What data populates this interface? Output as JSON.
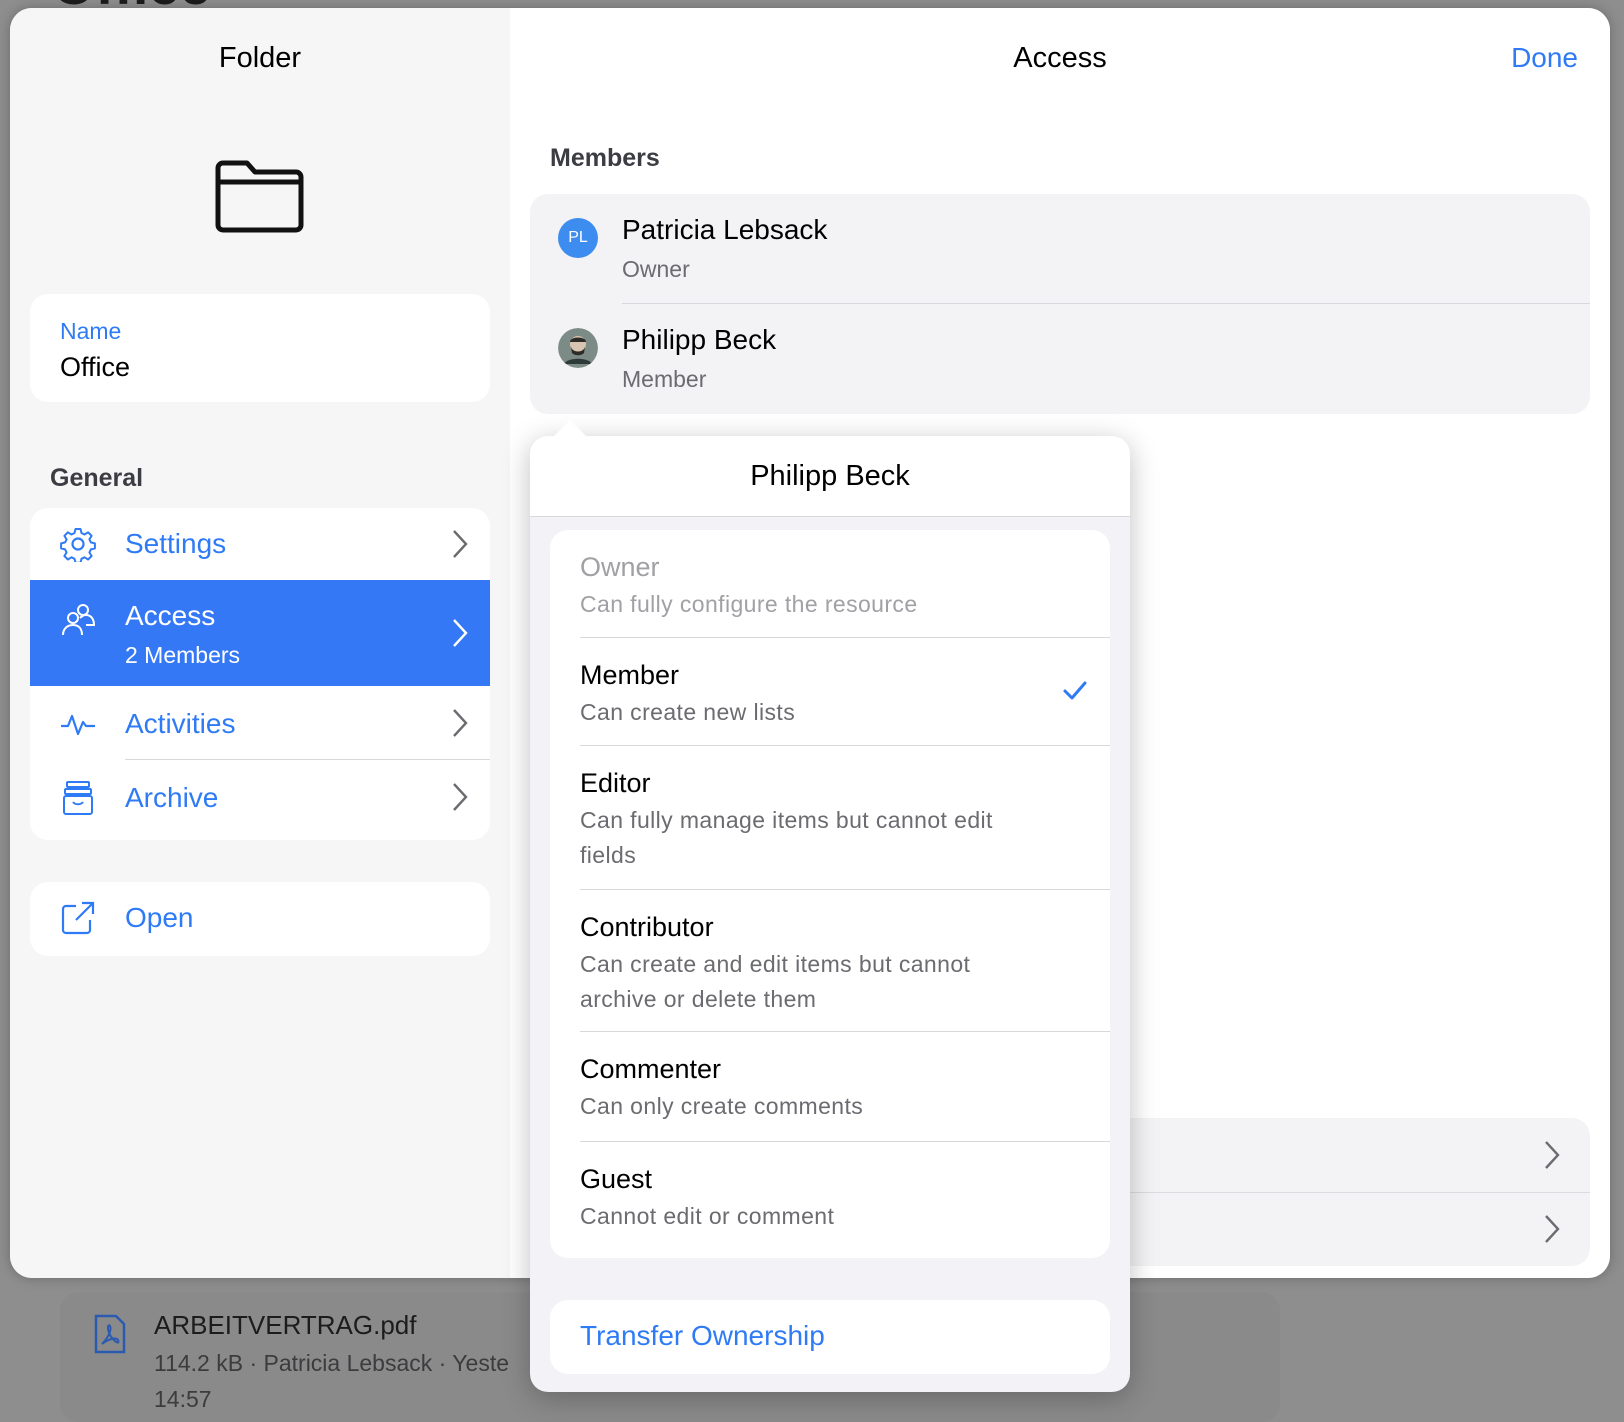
{
  "background": {
    "title": "Office",
    "file": {
      "name": "ARBEITVERTRAG.pdf",
      "meta": "114.2 kB · Patricia Lebsack · Yeste",
      "meta2": "14:57"
    }
  },
  "left": {
    "title": "Folder",
    "folder_icon": "folder-icon",
    "name_label": "Name",
    "name_value": "Office",
    "section_general": "General",
    "items": [
      {
        "label": "Settings",
        "icon": "gear-icon"
      },
      {
        "label": "Access",
        "sub": "2 Members",
        "icon": "people-icon",
        "selected": true
      },
      {
        "label": "Activities",
        "icon": "activity-icon"
      },
      {
        "label": "Archive",
        "icon": "archive-icon"
      }
    ],
    "open_label": "Open"
  },
  "right": {
    "title": "Access",
    "done_label": "Done",
    "members_header": "Members",
    "members": [
      {
        "name": "Patricia Lebsack",
        "role": "Owner",
        "initials": "PL"
      },
      {
        "name": "Philipp Beck",
        "role": "Member"
      }
    ]
  },
  "popover": {
    "title": "Philipp Beck",
    "roles": [
      {
        "name": "Owner",
        "desc": "Can fully configure the resource",
        "disabled": true
      },
      {
        "name": "Member",
        "desc": "Can create new lists",
        "selected": true
      },
      {
        "name": "Editor",
        "desc": "Can fully manage items but cannot edit fields"
      },
      {
        "name": "Contributor",
        "desc": "Can create and edit items but cannot archive or delete them"
      },
      {
        "name": "Commenter",
        "desc": "Can only create comments"
      },
      {
        "name": "Guest",
        "desc": "Cannot edit or comment"
      }
    ],
    "transfer_label": "Transfer Ownership"
  },
  "colors": {
    "accent": "#2f7bf5",
    "selected_row": "#3478f6"
  }
}
